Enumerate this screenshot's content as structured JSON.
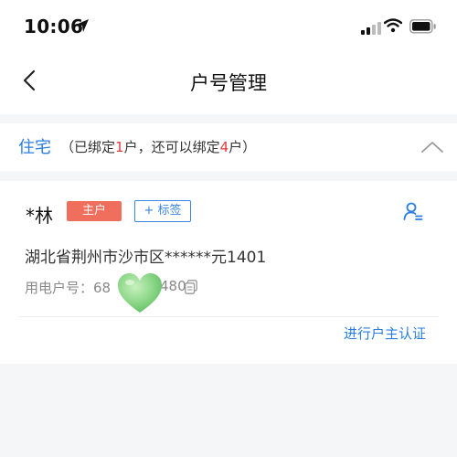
{
  "status_bar": {
    "time": "10:06",
    "icons": [
      "location-arrow-icon",
      "cellular-signal-icon",
      "wifi-icon",
      "battery-icon"
    ]
  },
  "nav": {
    "title": "户号管理",
    "back_icon": "chevron-left-icon"
  },
  "group": {
    "title": "住宅",
    "note_prefix": "（已绑定",
    "bound_count": "1",
    "note_mid": "户，还可以绑定",
    "remaining_count": "4",
    "note_suffix": "户）",
    "collapse_icon": "chevron-up-icon"
  },
  "account_card": {
    "name": "*林",
    "owner_badge": "主户",
    "tag_button": "+ 标签",
    "user_icon": "user-verify-icon",
    "address": "湖北省荆州市沙市区******元1401",
    "account_label": "用电户号：",
    "account_prefix": "68",
    "account_suffix": "480",
    "copy_icon": "copy-icon",
    "verify_link": "进行户主认证"
  },
  "colors": {
    "accent_blue": "#2a7de1",
    "badge_red": "#f06e5c",
    "count_red": "#e23b3b",
    "sticker_green": "#8fd88a"
  }
}
